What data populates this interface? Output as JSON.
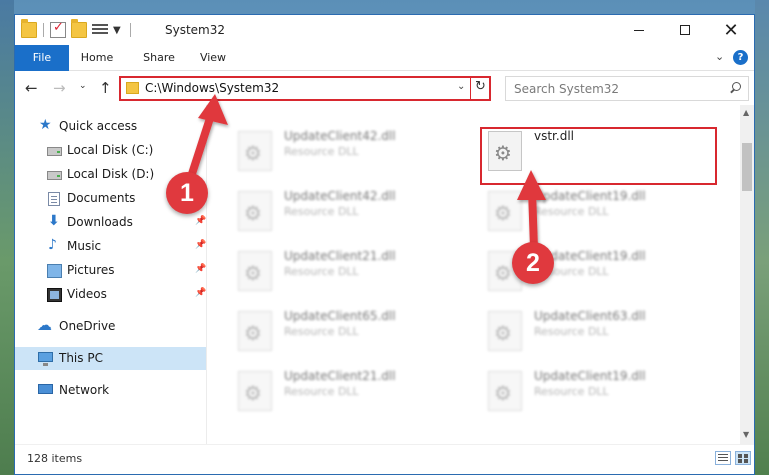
{
  "window": {
    "title": "System32",
    "minimize_glyph": "",
    "close_glyph": "✕"
  },
  "ribbon": {
    "tabs": [
      "File",
      "Home",
      "Share",
      "View"
    ],
    "expand_glyph": "⌄",
    "help_glyph": "?"
  },
  "navigation": {
    "back_glyph": "←",
    "forward_glyph": "→",
    "recent_glyph": "⌄",
    "up_glyph": "↑",
    "address": "C:\\Windows\\System32",
    "address_dropdown_glyph": "⌄",
    "refresh_glyph": "↻",
    "search_placeholder": "Search System32"
  },
  "sidebar": {
    "items": [
      {
        "label": "Quick access",
        "icon": "star-icon"
      },
      {
        "label": "Local Disk (C:)",
        "icon": "local-disk-icon"
      },
      {
        "label": "Local Disk (D:)",
        "icon": "local-disk-icon"
      },
      {
        "label": "Documents",
        "icon": "documents-icon"
      },
      {
        "label": "Downloads",
        "icon": "downloads-icon",
        "pinned": true
      },
      {
        "label": "Music",
        "icon": "music-icon",
        "pinned": true
      },
      {
        "label": "Pictures",
        "icon": "pictures-icon",
        "pinned": true
      },
      {
        "label": "Videos",
        "icon": "videos-icon",
        "pinned": true
      },
      {
        "label": "OneDrive",
        "icon": "onedrive-icon"
      },
      {
        "label": "This PC",
        "icon": "this-pc-icon",
        "selected": true
      },
      {
        "label": "Network",
        "icon": "network-icon"
      }
    ],
    "pin_glyph": "📌"
  },
  "files": [
    {
      "name": "UpdateClient42.dll",
      "type": "Resource DLL"
    },
    {
      "name": "vstr.dll",
      "type": ""
    },
    {
      "name": "UpdateClient42.dll",
      "type": "Resource DLL"
    },
    {
      "name": "UpdateClient19.dll",
      "type": "Resource DLL"
    },
    {
      "name": "UpdateClient21.dll",
      "type": "Resource DLL"
    },
    {
      "name": "UpdateClient19.dll",
      "type": "Resource DLL"
    },
    {
      "name": "UpdateClient65.dll",
      "type": "Resource DLL"
    },
    {
      "name": "UpdateClient63.dll",
      "type": "Resource DLL"
    },
    {
      "name": "UpdateClient21.dll",
      "type": "Resource DLL"
    },
    {
      "name": "UpdateClient19.dll",
      "type": "Resource DLL"
    }
  ],
  "status": {
    "item_count": "128 items"
  },
  "annotations": {
    "step1": "1",
    "step2": "2",
    "color": "#e0393e",
    "highlight_color": "#d8282f"
  },
  "scrollbar": {
    "up_glyph": "▲",
    "down_glyph": "▼"
  }
}
